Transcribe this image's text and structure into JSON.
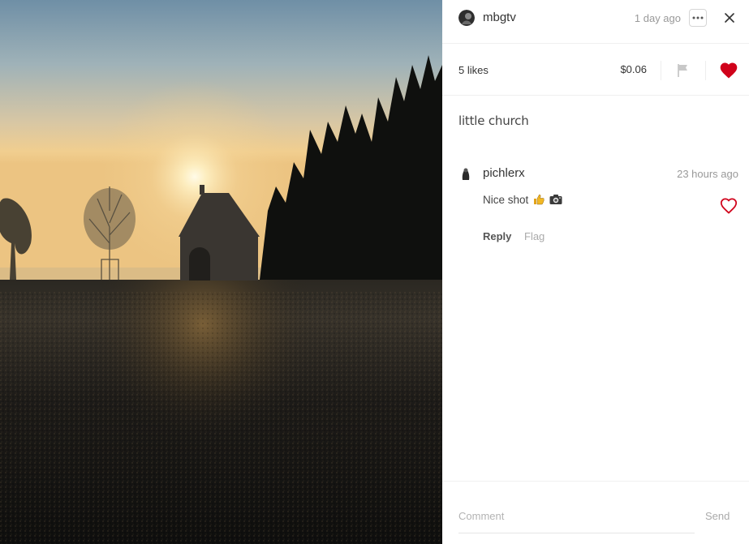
{
  "post": {
    "author": "mbgtv",
    "time": "1 day ago",
    "likes": "5 likes",
    "payout": "$0.06",
    "caption": "little church",
    "liked": true,
    "accent_color": "#d0021b"
  },
  "photo": {
    "subject": "silhouette of a small chapel at sunset"
  },
  "comments": [
    {
      "author": "pichlerx",
      "time": "23 hours ago",
      "text": "Nice shot",
      "emoji": [
        "thumbs-up-emoji",
        "camera-emoji"
      ],
      "reply_label": "Reply",
      "flag_label": "Flag"
    }
  ],
  "footer": {
    "placeholder": "Comment",
    "send_label": "Send"
  },
  "icons": {
    "more": "more-horizontal-icon",
    "close": "close-icon",
    "flag": "flag-icon",
    "heart": "heart-icon"
  }
}
